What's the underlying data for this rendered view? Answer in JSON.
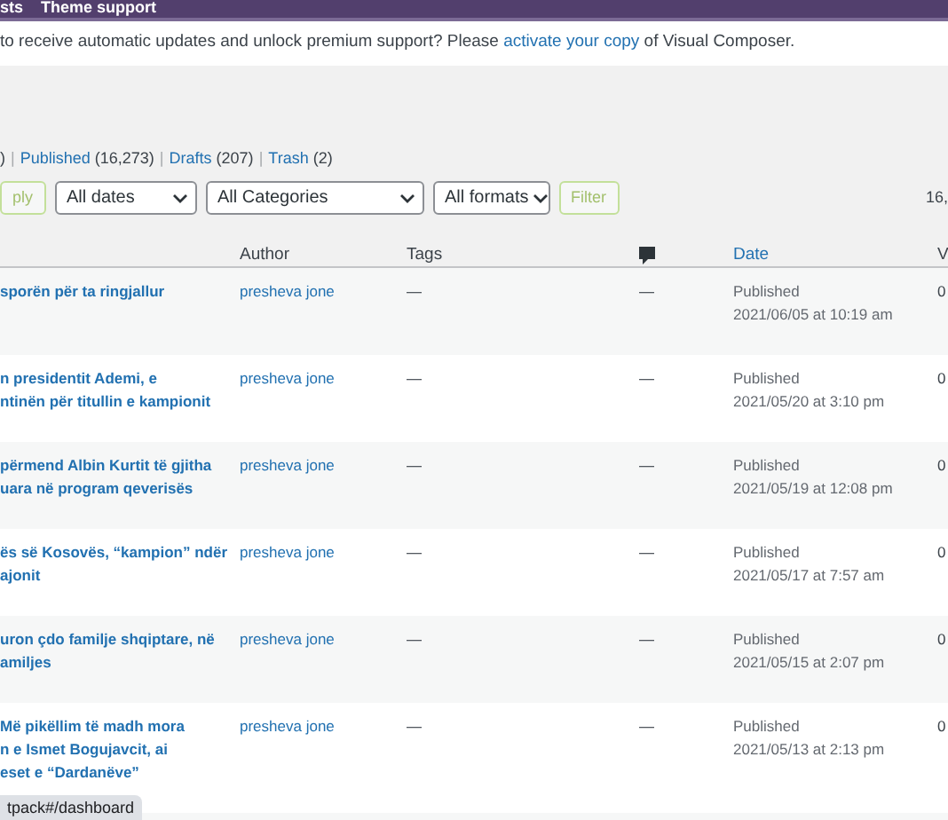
{
  "admin_bar": {
    "items": [
      "sts",
      "Theme support"
    ]
  },
  "notice": {
    "before": "to receive automatic updates and unlock premium support? Please ",
    "link": "activate your copy",
    "after": " of Visual Composer."
  },
  "status_links": {
    "separator": "|",
    "items": [
      {
        "kind": "text",
        "label": ")"
      },
      {
        "kind": "link",
        "label": "Published",
        "count": "(16,273)"
      },
      {
        "kind": "link",
        "label": "Drafts",
        "count": "(207)"
      },
      {
        "kind": "link",
        "label": "Trash",
        "count": "(2)"
      }
    ]
  },
  "filters": {
    "apply_button": "ply",
    "selects": [
      "All dates",
      "All Categories",
      "All formats"
    ],
    "filter_button": "Filter",
    "item_count": "16,"
  },
  "table": {
    "columns": [
      "Author",
      "Tags",
      "Date",
      "V"
    ],
    "rows": [
      {
        "title_lines": [
          "sporën për ta ringjallur"
        ],
        "author": "presheva jone",
        "tags": "—",
        "comments": "—",
        "status": "Published",
        "date": "2021/06/05 at 10:19 am",
        "views": "0"
      },
      {
        "title_lines": [
          "n presidentit Ademi, e",
          "ntinën për titullin e kampionit"
        ],
        "author": "presheva jone",
        "tags": "—",
        "comments": "—",
        "status": "Published",
        "date": "2021/05/20 at 3:10 pm",
        "views": "0"
      },
      {
        "title_lines": [
          "përmend Albin Kurtit të gjitha",
          "uara në program qeverisës"
        ],
        "author": "presheva jone",
        "tags": "—",
        "comments": "—",
        "status": "Published",
        "date": "2021/05/19 at 12:08 pm",
        "views": "0"
      },
      {
        "title_lines": [
          "ës së Kosovës, “kampion” ndër",
          "ajonit"
        ],
        "author": "presheva jone",
        "tags": "—",
        "comments": "—",
        "status": "Published",
        "date": "2021/05/17 at 7:57 am",
        "views": "0"
      },
      {
        "title_lines": [
          "uron çdo familje shqiptare, në",
          "amiljes"
        ],
        "author": "presheva jone",
        "tags": "—",
        "comments": "—",
        "status": "Published",
        "date": "2021/05/15 at 2:07 pm",
        "views": "0"
      },
      {
        "title_lines": [
          "Më pikëllim të madh mora",
          "n e Ismet Bogujavcit, ai",
          "eset e “Dardanëve”"
        ],
        "author": "presheva jone",
        "tags": "—",
        "comments": "—",
        "status": "Published",
        "date": "2021/05/13 at 2:13 pm",
        "views": "0"
      }
    ]
  },
  "status_tooltip": "tpack#/dashboard"
}
